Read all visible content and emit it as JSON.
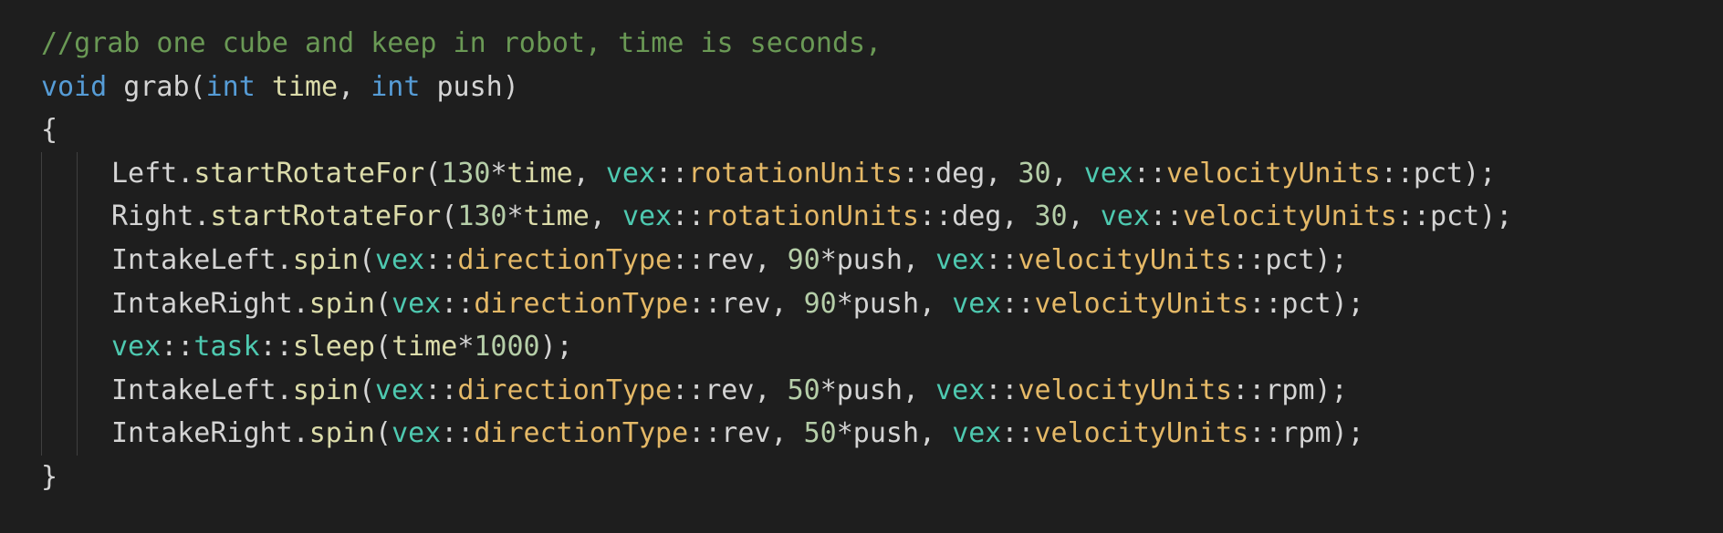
{
  "editor": {
    "colors": {
      "background": "#1e1e1e",
      "comment": "#6a9955",
      "keyword": "#569cd6",
      "function": "#dcdcaa",
      "namespace": "#4ec9b0",
      "enum_type": "#e5b967",
      "number": "#b5cea8",
      "plain": "#d4d4d4"
    },
    "lines": [
      {
        "indent": 0,
        "tokens": [
          {
            "t": "//grab one cube and keep in robot, time is seconds,",
            "c": "comment"
          }
        ]
      },
      {
        "indent": 0,
        "tokens": [
          {
            "t": "void",
            "c": "keyword"
          },
          {
            "t": " grab(",
            "c": "plain"
          },
          {
            "t": "int",
            "c": "keyword"
          },
          {
            "t": " ",
            "c": "plain"
          },
          {
            "t": "time",
            "c": "func"
          },
          {
            "t": ", ",
            "c": "plain"
          },
          {
            "t": "int",
            "c": "keyword"
          },
          {
            "t": " push)",
            "c": "plain"
          }
        ]
      },
      {
        "indent": 0,
        "tokens": [
          {
            "t": "{",
            "c": "plain"
          }
        ]
      },
      {
        "indent": 1,
        "tokens": [
          {
            "t": "Left.",
            "c": "plain"
          },
          {
            "t": "startRotateFor",
            "c": "func"
          },
          {
            "t": "(",
            "c": "plain"
          },
          {
            "t": "130",
            "c": "number"
          },
          {
            "t": "*",
            "c": "plain"
          },
          {
            "t": "time",
            "c": "func"
          },
          {
            "t": ", ",
            "c": "plain"
          },
          {
            "t": "vex",
            "c": "ns"
          },
          {
            "t": "::",
            "c": "plain"
          },
          {
            "t": "rotationUnits",
            "c": "enum"
          },
          {
            "t": "::deg, ",
            "c": "plain"
          },
          {
            "t": "30",
            "c": "number"
          },
          {
            "t": ", ",
            "c": "plain"
          },
          {
            "t": "vex",
            "c": "ns"
          },
          {
            "t": "::",
            "c": "plain"
          },
          {
            "t": "velocityUnits",
            "c": "enum"
          },
          {
            "t": "::pct);",
            "c": "plain"
          }
        ]
      },
      {
        "indent": 1,
        "tokens": [
          {
            "t": "Right.",
            "c": "plain"
          },
          {
            "t": "startRotateFor",
            "c": "func"
          },
          {
            "t": "(",
            "c": "plain"
          },
          {
            "t": "130",
            "c": "number"
          },
          {
            "t": "*",
            "c": "plain"
          },
          {
            "t": "time",
            "c": "func"
          },
          {
            "t": ", ",
            "c": "plain"
          },
          {
            "t": "vex",
            "c": "ns"
          },
          {
            "t": "::",
            "c": "plain"
          },
          {
            "t": "rotationUnits",
            "c": "enum"
          },
          {
            "t": "::deg, ",
            "c": "plain"
          },
          {
            "t": "30",
            "c": "number"
          },
          {
            "t": ", ",
            "c": "plain"
          },
          {
            "t": "vex",
            "c": "ns"
          },
          {
            "t": "::",
            "c": "plain"
          },
          {
            "t": "velocityUnits",
            "c": "enum"
          },
          {
            "t": "::pct);",
            "c": "plain"
          }
        ]
      },
      {
        "indent": 1,
        "tokens": [
          {
            "t": "IntakeLeft.",
            "c": "plain"
          },
          {
            "t": "spin",
            "c": "func"
          },
          {
            "t": "(",
            "c": "plain"
          },
          {
            "t": "vex",
            "c": "ns"
          },
          {
            "t": "::",
            "c": "plain"
          },
          {
            "t": "directionType",
            "c": "enum"
          },
          {
            "t": "::rev, ",
            "c": "plain"
          },
          {
            "t": "90",
            "c": "number"
          },
          {
            "t": "*push, ",
            "c": "plain"
          },
          {
            "t": "vex",
            "c": "ns"
          },
          {
            "t": "::",
            "c": "plain"
          },
          {
            "t": "velocityUnits",
            "c": "enum"
          },
          {
            "t": "::pct);",
            "c": "plain"
          }
        ]
      },
      {
        "indent": 1,
        "tokens": [
          {
            "t": "IntakeRight.",
            "c": "plain"
          },
          {
            "t": "spin",
            "c": "func"
          },
          {
            "t": "(",
            "c": "plain"
          },
          {
            "t": "vex",
            "c": "ns"
          },
          {
            "t": "::",
            "c": "plain"
          },
          {
            "t": "directionType",
            "c": "enum"
          },
          {
            "t": "::rev, ",
            "c": "plain"
          },
          {
            "t": "90",
            "c": "number"
          },
          {
            "t": "*push, ",
            "c": "plain"
          },
          {
            "t": "vex",
            "c": "ns"
          },
          {
            "t": "::",
            "c": "plain"
          },
          {
            "t": "velocityUnits",
            "c": "enum"
          },
          {
            "t": "::pct);",
            "c": "plain"
          }
        ]
      },
      {
        "indent": 1,
        "tokens": [
          {
            "t": "vex",
            "c": "ns"
          },
          {
            "t": "::",
            "c": "plain"
          },
          {
            "t": "task",
            "c": "ns"
          },
          {
            "t": "::",
            "c": "plain"
          },
          {
            "t": "sleep",
            "c": "func"
          },
          {
            "t": "(",
            "c": "plain"
          },
          {
            "t": "time",
            "c": "func"
          },
          {
            "t": "*",
            "c": "plain"
          },
          {
            "t": "1000",
            "c": "number"
          },
          {
            "t": ");",
            "c": "plain"
          }
        ]
      },
      {
        "indent": 1,
        "tokens": [
          {
            "t": "IntakeLeft.",
            "c": "plain"
          },
          {
            "t": "spin",
            "c": "func"
          },
          {
            "t": "(",
            "c": "plain"
          },
          {
            "t": "vex",
            "c": "ns"
          },
          {
            "t": "::",
            "c": "plain"
          },
          {
            "t": "directionType",
            "c": "enum"
          },
          {
            "t": "::rev, ",
            "c": "plain"
          },
          {
            "t": "50",
            "c": "number"
          },
          {
            "t": "*push, ",
            "c": "plain"
          },
          {
            "t": "vex",
            "c": "ns"
          },
          {
            "t": "::",
            "c": "plain"
          },
          {
            "t": "velocityUnits",
            "c": "enum"
          },
          {
            "t": "::rpm);",
            "c": "plain"
          }
        ]
      },
      {
        "indent": 1,
        "tokens": [
          {
            "t": "IntakeRight.",
            "c": "plain"
          },
          {
            "t": "spin",
            "c": "func"
          },
          {
            "t": "(",
            "c": "plain"
          },
          {
            "t": "vex",
            "c": "ns"
          },
          {
            "t": "::",
            "c": "plain"
          },
          {
            "t": "directionType",
            "c": "enum"
          },
          {
            "t": "::rev, ",
            "c": "plain"
          },
          {
            "t": "50",
            "c": "number"
          },
          {
            "t": "*push, ",
            "c": "plain"
          },
          {
            "t": "vex",
            "c": "ns"
          },
          {
            "t": "::",
            "c": "plain"
          },
          {
            "t": "velocityUnits",
            "c": "enum"
          },
          {
            "t": "::rpm);",
            "c": "plain"
          }
        ]
      },
      {
        "indent": 0,
        "tokens": [
          {
            "t": "}",
            "c": "plain"
          }
        ]
      }
    ]
  }
}
